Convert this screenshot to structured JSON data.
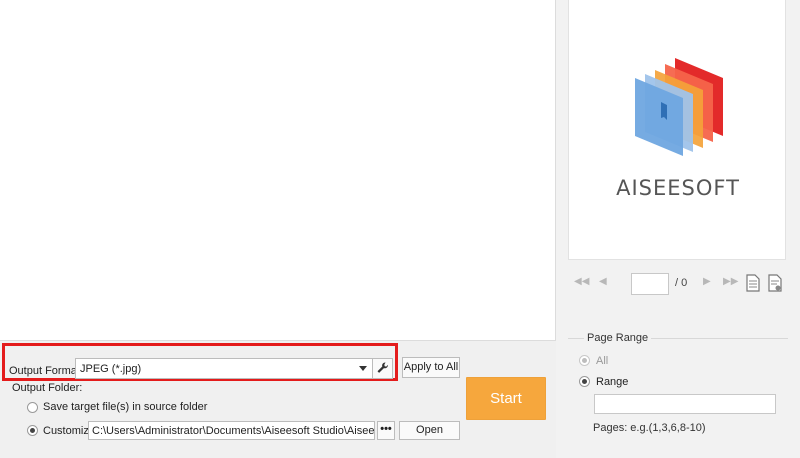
{
  "output": {
    "format_label": "Output Format:",
    "format_value": "JPEG (*.jpg)",
    "apply_all_label": "Apply to All",
    "folder_label": "Output Folder:",
    "save_source_label": "Save target file(s) in source folder",
    "customize_label": "Customize:",
    "path_value": "C:\\Users\\Administrator\\Documents\\Aiseesoft Studio\\Aiseesoft PDF Co",
    "browse_label": "•••",
    "open_label": "Open",
    "start_label": "Start"
  },
  "preview": {
    "logo_text": "AISEESOFT",
    "page_total": "/ 0"
  },
  "page_range": {
    "title": "Page Range",
    "all_label": "All",
    "range_label": "Range",
    "hint": "Pages: e.g.(1,3,6,8-10)"
  },
  "colors": {
    "highlight": "#e41b1b",
    "start_button": "#f6a73d"
  }
}
